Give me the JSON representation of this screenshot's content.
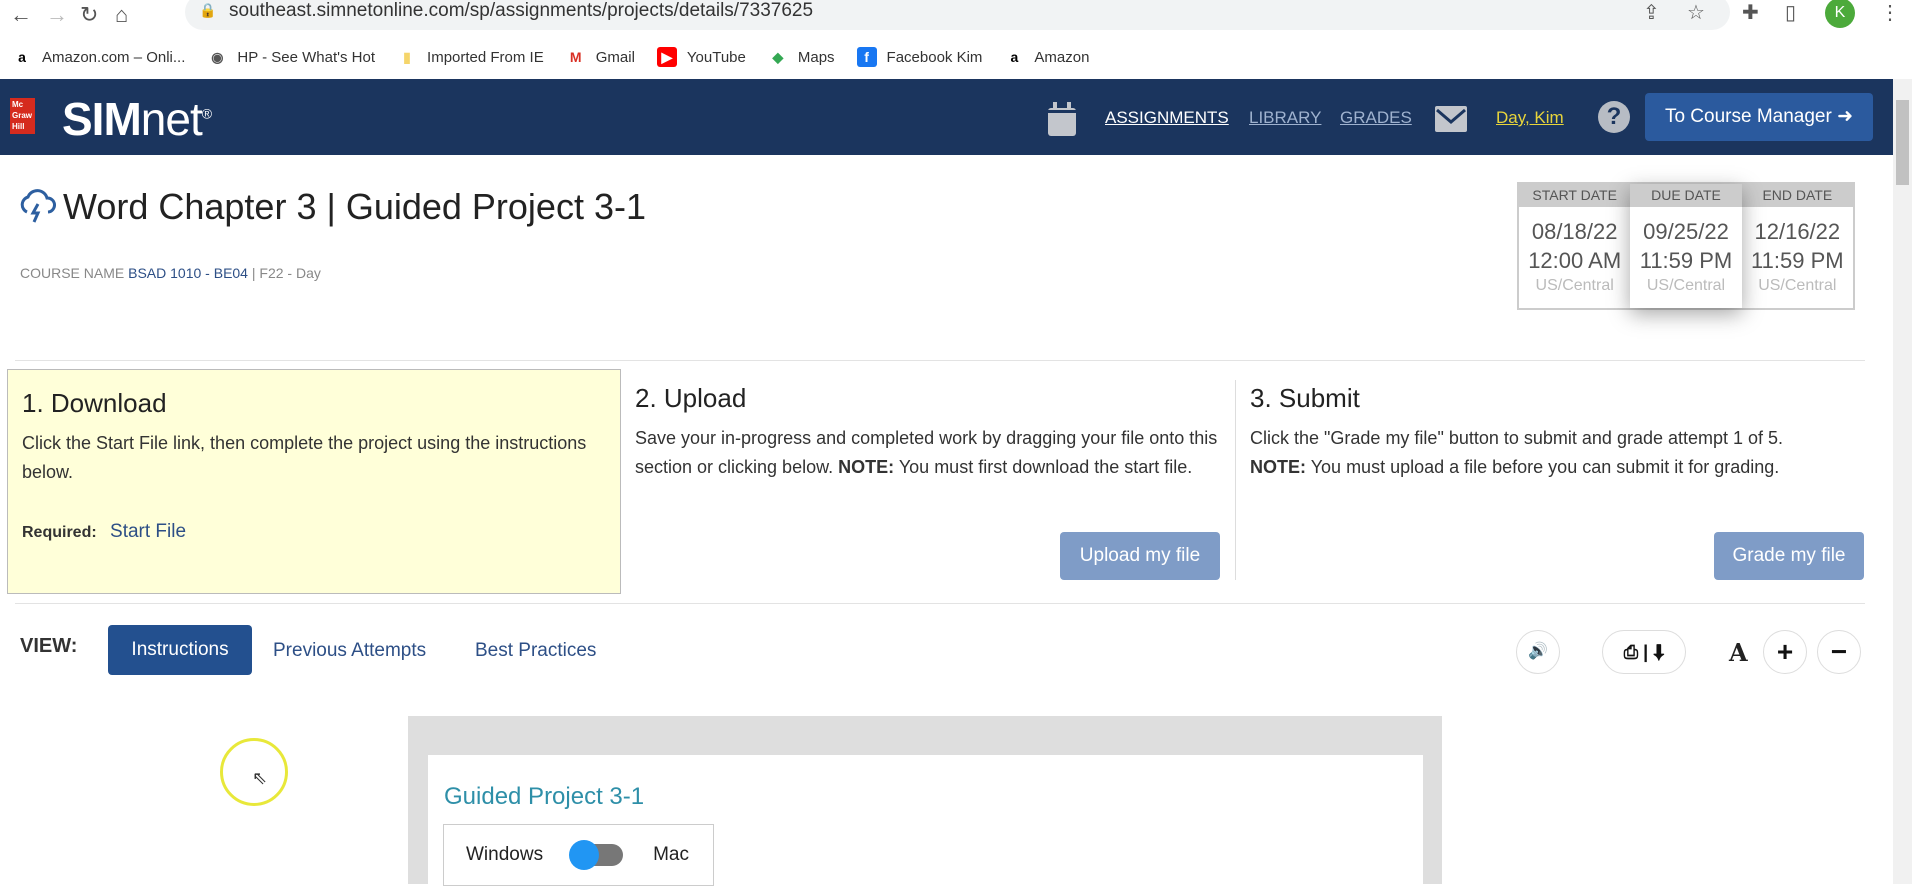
{
  "browser": {
    "url": "southeast.simnetonline.com/sp/assignments/projects/details/7337625",
    "avatar": "K",
    "bookmarks": [
      {
        "label": "Amazon.com – Onli...",
        "icon": "amazon-icon"
      },
      {
        "label": "HP - See What's Hot",
        "icon": "globe-icon"
      },
      {
        "label": "Imported From IE",
        "icon": "folder-icon"
      },
      {
        "label": "Gmail",
        "icon": "gmail-icon"
      },
      {
        "label": "YouTube",
        "icon": "youtube-icon"
      },
      {
        "label": "Maps",
        "icon": "maps-icon"
      },
      {
        "label": "Facebook Kim",
        "icon": "facebook-icon"
      },
      {
        "label": "Amazon",
        "icon": "amazon-icon"
      }
    ]
  },
  "header": {
    "logo_box": "Mc Graw Hill",
    "logo_bold": "SIM",
    "logo_light": "net",
    "logo_reg": "®",
    "nav": {
      "assignments": "ASSIGNMENTS",
      "library": "LIBRARY",
      "grades": "GRADES",
      "user": "Day, Kim"
    },
    "help": "?",
    "course_manager": "To Course Manager"
  },
  "assignment": {
    "title": "Word Chapter 3 | Guided Project 3-1",
    "course_label": "COURSE NAME",
    "course_name": "BSAD 1010 - BE04",
    "course_sep": " | ",
    "term": "F22 - Day"
  },
  "dates": [
    {
      "label": "START DATE",
      "date": "08/18/22",
      "time": "12:00 AM",
      "tz": "US/Central"
    },
    {
      "label": "DUE DATE",
      "date": "09/25/22",
      "time": "11:59 PM",
      "tz": "US/Central"
    },
    {
      "label": "END DATE",
      "date": "12/16/22",
      "time": "11:59 PM",
      "tz": "US/Central"
    }
  ],
  "steps": {
    "download": {
      "title": "1. Download",
      "text": "Click the Start File link, then complete the project using the instructions below.",
      "required_label": "Required:",
      "link": "Start File"
    },
    "upload": {
      "title": "2. Upload",
      "text": "Save your in-progress and completed work by dragging your file onto this section or clicking below.",
      "note_label": "NOTE:",
      "note": "You must first download the start file.",
      "button": "Upload my file"
    },
    "submit": {
      "title": "3. Submit",
      "text": "Click the \"Grade my file\" button to submit and grade attempt 1 of 5.",
      "note_label": "NOTE:",
      "note": "You must upload a file before you can submit it for grading.",
      "button": "Grade my file"
    }
  },
  "view": {
    "label": "VIEW:",
    "tabs": [
      "Instructions",
      "Previous Attempts",
      "Best Practices"
    ],
    "font_label": "A",
    "plus": "+",
    "minus": "−"
  },
  "content": {
    "heading": "Guided Project 3-1",
    "toggle_left": "Windows",
    "toggle_right": "Mac"
  }
}
